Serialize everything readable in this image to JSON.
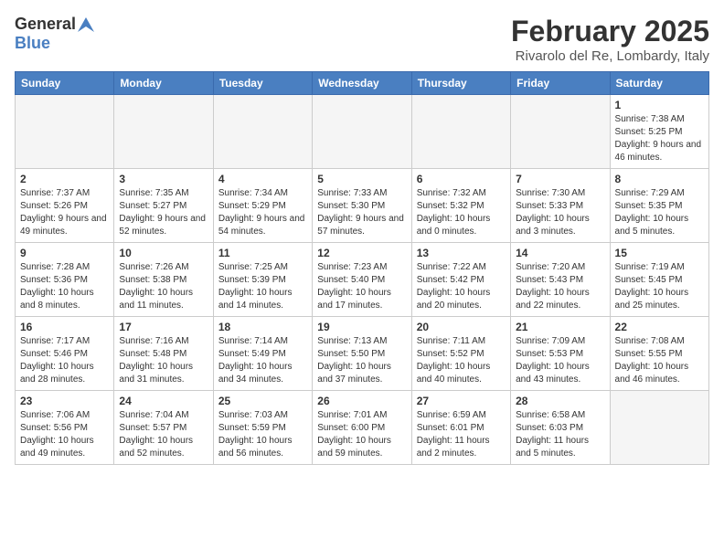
{
  "header": {
    "logo_general": "General",
    "logo_blue": "Blue",
    "title": "February 2025",
    "subtitle": "Rivarolo del Re, Lombardy, Italy"
  },
  "weekdays": [
    "Sunday",
    "Monday",
    "Tuesday",
    "Wednesday",
    "Thursday",
    "Friday",
    "Saturday"
  ],
  "weeks": [
    [
      {
        "day": "",
        "info": ""
      },
      {
        "day": "",
        "info": ""
      },
      {
        "day": "",
        "info": ""
      },
      {
        "day": "",
        "info": ""
      },
      {
        "day": "",
        "info": ""
      },
      {
        "day": "",
        "info": ""
      },
      {
        "day": "1",
        "info": "Sunrise: 7:38 AM\nSunset: 5:25 PM\nDaylight: 9 hours and 46 minutes."
      }
    ],
    [
      {
        "day": "2",
        "info": "Sunrise: 7:37 AM\nSunset: 5:26 PM\nDaylight: 9 hours and 49 minutes."
      },
      {
        "day": "3",
        "info": "Sunrise: 7:35 AM\nSunset: 5:27 PM\nDaylight: 9 hours and 52 minutes."
      },
      {
        "day": "4",
        "info": "Sunrise: 7:34 AM\nSunset: 5:29 PM\nDaylight: 9 hours and 54 minutes."
      },
      {
        "day": "5",
        "info": "Sunrise: 7:33 AM\nSunset: 5:30 PM\nDaylight: 9 hours and 57 minutes."
      },
      {
        "day": "6",
        "info": "Sunrise: 7:32 AM\nSunset: 5:32 PM\nDaylight: 10 hours and 0 minutes."
      },
      {
        "day": "7",
        "info": "Sunrise: 7:30 AM\nSunset: 5:33 PM\nDaylight: 10 hours and 3 minutes."
      },
      {
        "day": "8",
        "info": "Sunrise: 7:29 AM\nSunset: 5:35 PM\nDaylight: 10 hours and 5 minutes."
      }
    ],
    [
      {
        "day": "9",
        "info": "Sunrise: 7:28 AM\nSunset: 5:36 PM\nDaylight: 10 hours and 8 minutes."
      },
      {
        "day": "10",
        "info": "Sunrise: 7:26 AM\nSunset: 5:38 PM\nDaylight: 10 hours and 11 minutes."
      },
      {
        "day": "11",
        "info": "Sunrise: 7:25 AM\nSunset: 5:39 PM\nDaylight: 10 hours and 14 minutes."
      },
      {
        "day": "12",
        "info": "Sunrise: 7:23 AM\nSunset: 5:40 PM\nDaylight: 10 hours and 17 minutes."
      },
      {
        "day": "13",
        "info": "Sunrise: 7:22 AM\nSunset: 5:42 PM\nDaylight: 10 hours and 20 minutes."
      },
      {
        "day": "14",
        "info": "Sunrise: 7:20 AM\nSunset: 5:43 PM\nDaylight: 10 hours and 22 minutes."
      },
      {
        "day": "15",
        "info": "Sunrise: 7:19 AM\nSunset: 5:45 PM\nDaylight: 10 hours and 25 minutes."
      }
    ],
    [
      {
        "day": "16",
        "info": "Sunrise: 7:17 AM\nSunset: 5:46 PM\nDaylight: 10 hours and 28 minutes."
      },
      {
        "day": "17",
        "info": "Sunrise: 7:16 AM\nSunset: 5:48 PM\nDaylight: 10 hours and 31 minutes."
      },
      {
        "day": "18",
        "info": "Sunrise: 7:14 AM\nSunset: 5:49 PM\nDaylight: 10 hours and 34 minutes."
      },
      {
        "day": "19",
        "info": "Sunrise: 7:13 AM\nSunset: 5:50 PM\nDaylight: 10 hours and 37 minutes."
      },
      {
        "day": "20",
        "info": "Sunrise: 7:11 AM\nSunset: 5:52 PM\nDaylight: 10 hours and 40 minutes."
      },
      {
        "day": "21",
        "info": "Sunrise: 7:09 AM\nSunset: 5:53 PM\nDaylight: 10 hours and 43 minutes."
      },
      {
        "day": "22",
        "info": "Sunrise: 7:08 AM\nSunset: 5:55 PM\nDaylight: 10 hours and 46 minutes."
      }
    ],
    [
      {
        "day": "23",
        "info": "Sunrise: 7:06 AM\nSunset: 5:56 PM\nDaylight: 10 hours and 49 minutes."
      },
      {
        "day": "24",
        "info": "Sunrise: 7:04 AM\nSunset: 5:57 PM\nDaylight: 10 hours and 52 minutes."
      },
      {
        "day": "25",
        "info": "Sunrise: 7:03 AM\nSunset: 5:59 PM\nDaylight: 10 hours and 56 minutes."
      },
      {
        "day": "26",
        "info": "Sunrise: 7:01 AM\nSunset: 6:00 PM\nDaylight: 10 hours and 59 minutes."
      },
      {
        "day": "27",
        "info": "Sunrise: 6:59 AM\nSunset: 6:01 PM\nDaylight: 11 hours and 2 minutes."
      },
      {
        "day": "28",
        "info": "Sunrise: 6:58 AM\nSunset: 6:03 PM\nDaylight: 11 hours and 5 minutes."
      },
      {
        "day": "",
        "info": ""
      }
    ]
  ]
}
